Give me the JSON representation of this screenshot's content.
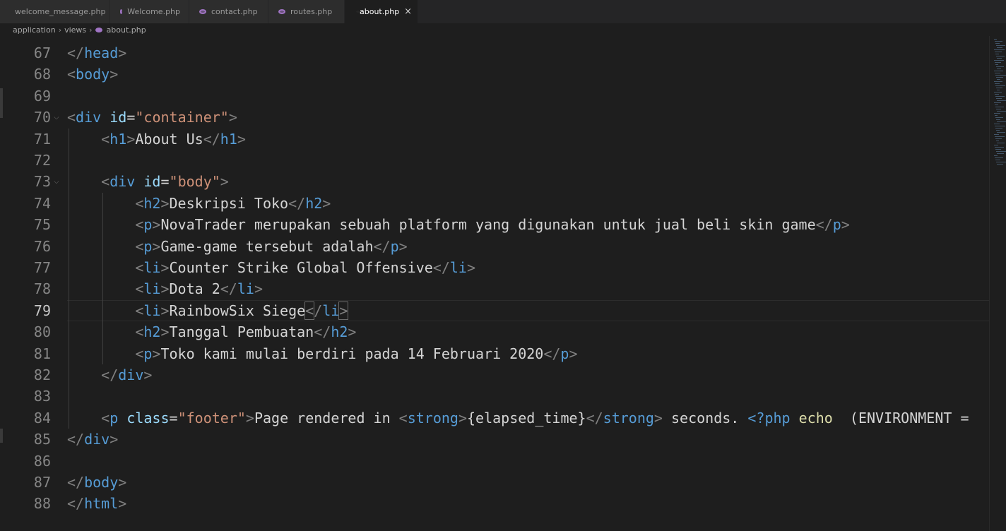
{
  "tabs": [
    {
      "label": "welcome_message.php",
      "active": false
    },
    {
      "label": "Welcome.php",
      "active": false
    },
    {
      "label": "contact.php",
      "active": false
    },
    {
      "label": "routes.php",
      "active": false
    },
    {
      "label": "about.php",
      "active": true
    }
  ],
  "breadcrumb": {
    "parts": [
      "application",
      "views"
    ],
    "file": "about.php"
  },
  "editor": {
    "current_line": "79",
    "lines": [
      {
        "n": "67",
        "text": "</head>"
      },
      {
        "n": "68",
        "text": "<body>"
      },
      {
        "n": "69",
        "text": ""
      },
      {
        "n": "70",
        "text": "<div id=\"container\">"
      },
      {
        "n": "71",
        "text": "    <h1>About Us</h1>"
      },
      {
        "n": "72",
        "text": ""
      },
      {
        "n": "73",
        "text": "    <div id=\"body\">"
      },
      {
        "n": "74",
        "text": "        <h2>Deskripsi Toko</h2>"
      },
      {
        "n": "75",
        "text": "        <p>NovaTrader merupakan sebuah platform yang digunakan untuk jual beli skin game</p>"
      },
      {
        "n": "76",
        "text": "        <p>Game-game tersebut adalah</p>"
      },
      {
        "n": "77",
        "text": "        <li>Counter Strike Global Offensive</li>"
      },
      {
        "n": "78",
        "text": "        <li>Dota 2</li>"
      },
      {
        "n": "79",
        "text": "        <li>RainbowSix Siege</li>"
      },
      {
        "n": "80",
        "text": "        <h2>Tanggal Pembuatan</h2>"
      },
      {
        "n": "81",
        "text": "        <p>Toko kami mulai berdiri pada 14 Februari 2020</p>"
      },
      {
        "n": "82",
        "text": "    </div>"
      },
      {
        "n": "83",
        "text": ""
      },
      {
        "n": "84",
        "text": "    <p class=\"footer\">Page rendered in <strong>{elapsed_time}</strong> seconds. <?php echo  (ENVIRONMENT ="
      },
      {
        "n": "85",
        "text": "</div>"
      },
      {
        "n": "86",
        "text": ""
      },
      {
        "n": "87",
        "text": "</body>"
      },
      {
        "n": "88",
        "text": "</html>"
      }
    ]
  },
  "colors": {
    "background": "#1e1e1e",
    "tag": "#569cd6",
    "attribute": "#9cdcfe",
    "string": "#ce9178",
    "text": "#d4d4d4",
    "function": "#dcdcaa"
  }
}
